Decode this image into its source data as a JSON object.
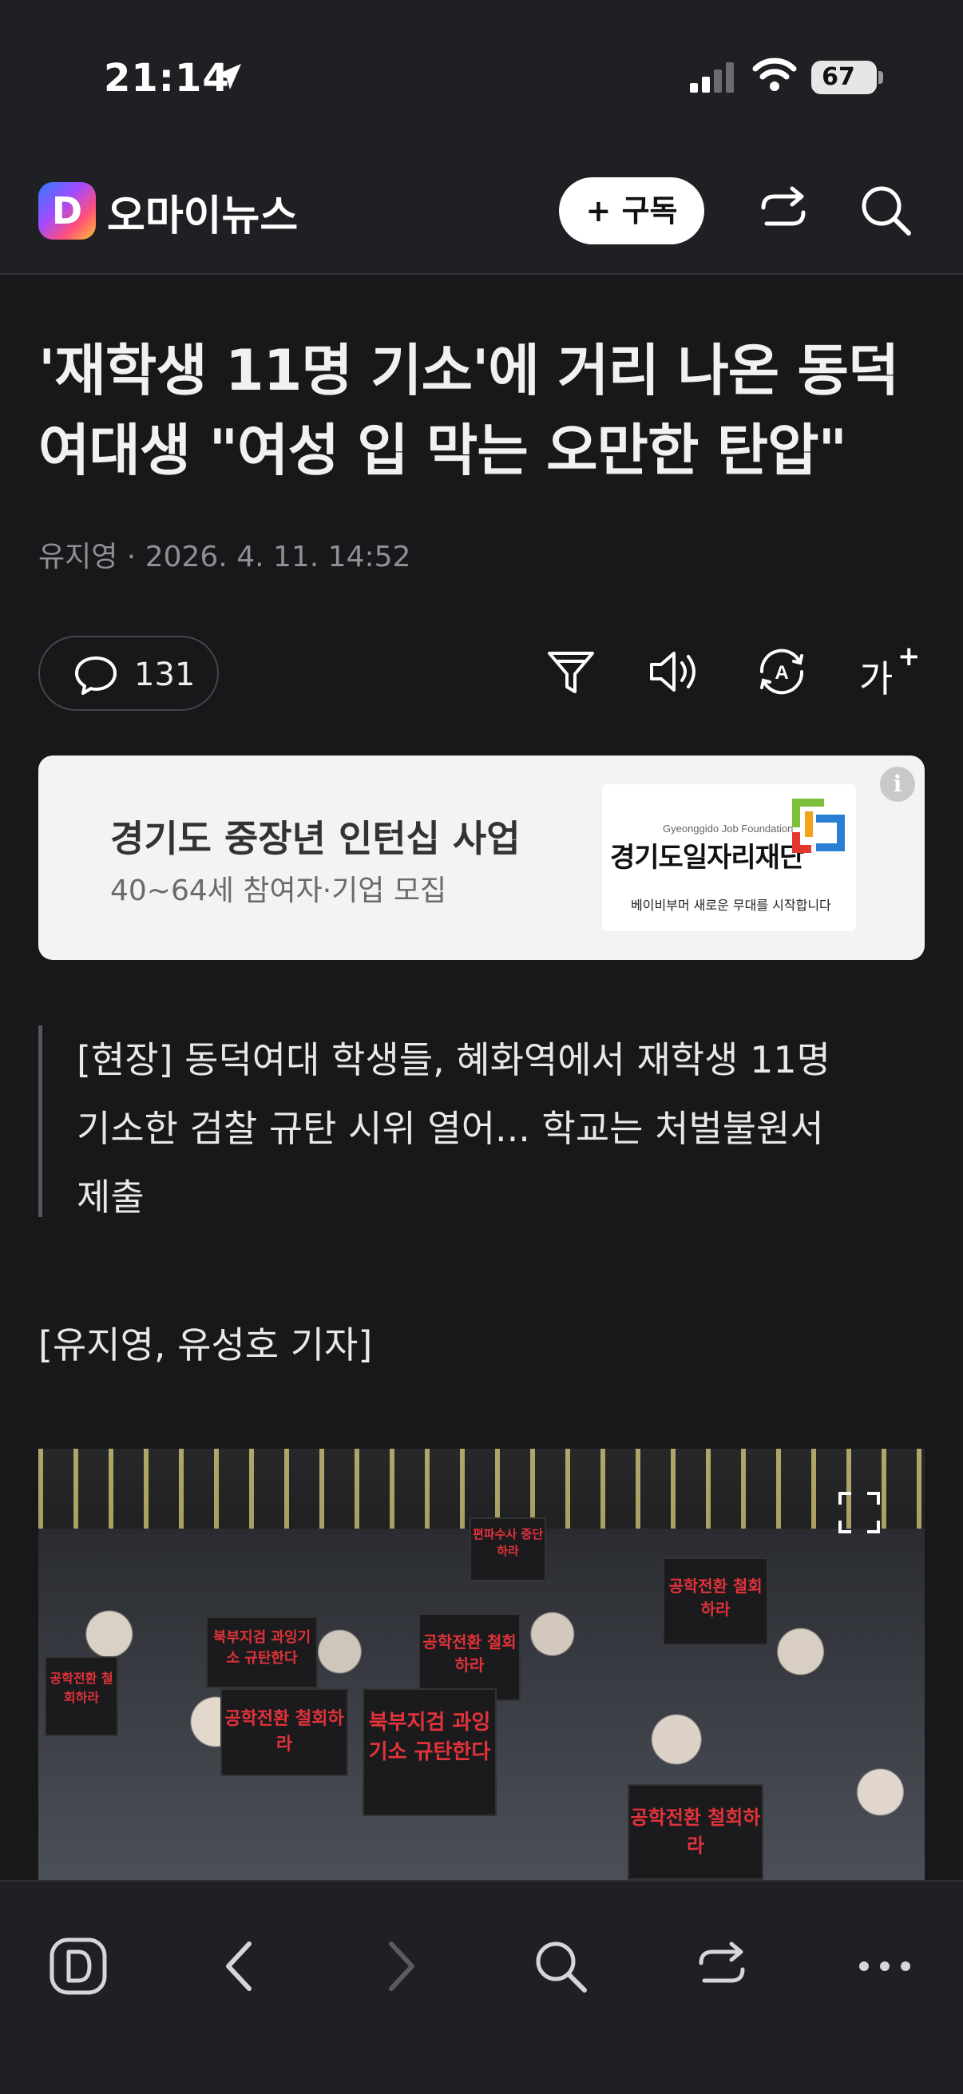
{
  "status_bar": {
    "time": "21:14",
    "battery": "67"
  },
  "header": {
    "brand": "오마이뉴스",
    "brand_letter": "D",
    "subscribe_label": "+ 구독"
  },
  "article": {
    "headline_line1": "'재학생 11명 기소'에 거리 나온 동덕",
    "headline_line2": "여대생 \"여성 입 막는 오만한 탄압\"",
    "byline": "유지영 · 2026. 4. 11. 14:52",
    "comment_count": "131",
    "font_size_label": "가",
    "summary_line1": "[현장] 동덕여대 학생들, 혜화역에서 재학생 11명",
    "summary_line2": "기소한 검찰 규탄 시위 열어... 학교는 처벌불원서",
    "summary_line3": "제출",
    "reporters": "[유지영, 유성호 기자]"
  },
  "ad": {
    "title": "경기도 중장년 인턴십 사업",
    "subtitle": "40~64세 참여자·기업 모집",
    "logo_en": "Gyeonggido Job Foundation",
    "logo_ko": "경기도일자리재단",
    "logo_tagline": "베이비부머 새로운 무대를 시작합니다",
    "info": "i"
  },
  "photo": {
    "signs": [
      "공학전환 철회하라",
      "북부지검 과잉기소 규탄한다",
      "공학전환 철회하라",
      "공학전환 철회하라",
      "공학전환 철회하라",
      "북부지검 과잉기소 규탄한다",
      "편파수사 중단하라",
      "공학전환 철회하라"
    ]
  },
  "icons": {
    "status": [
      "location-arrow-icon",
      "signal-icon",
      "wifi-icon"
    ],
    "header": [
      "share-icon",
      "search-icon"
    ],
    "toolbar": [
      "comment-icon",
      "filter-icon",
      "speaker-icon",
      "translate-icon",
      "font-size-icon"
    ],
    "bottom": [
      "daum-home-icon",
      "back-icon",
      "forward-icon",
      "search-icon",
      "share-icon",
      "more-icon"
    ]
  }
}
